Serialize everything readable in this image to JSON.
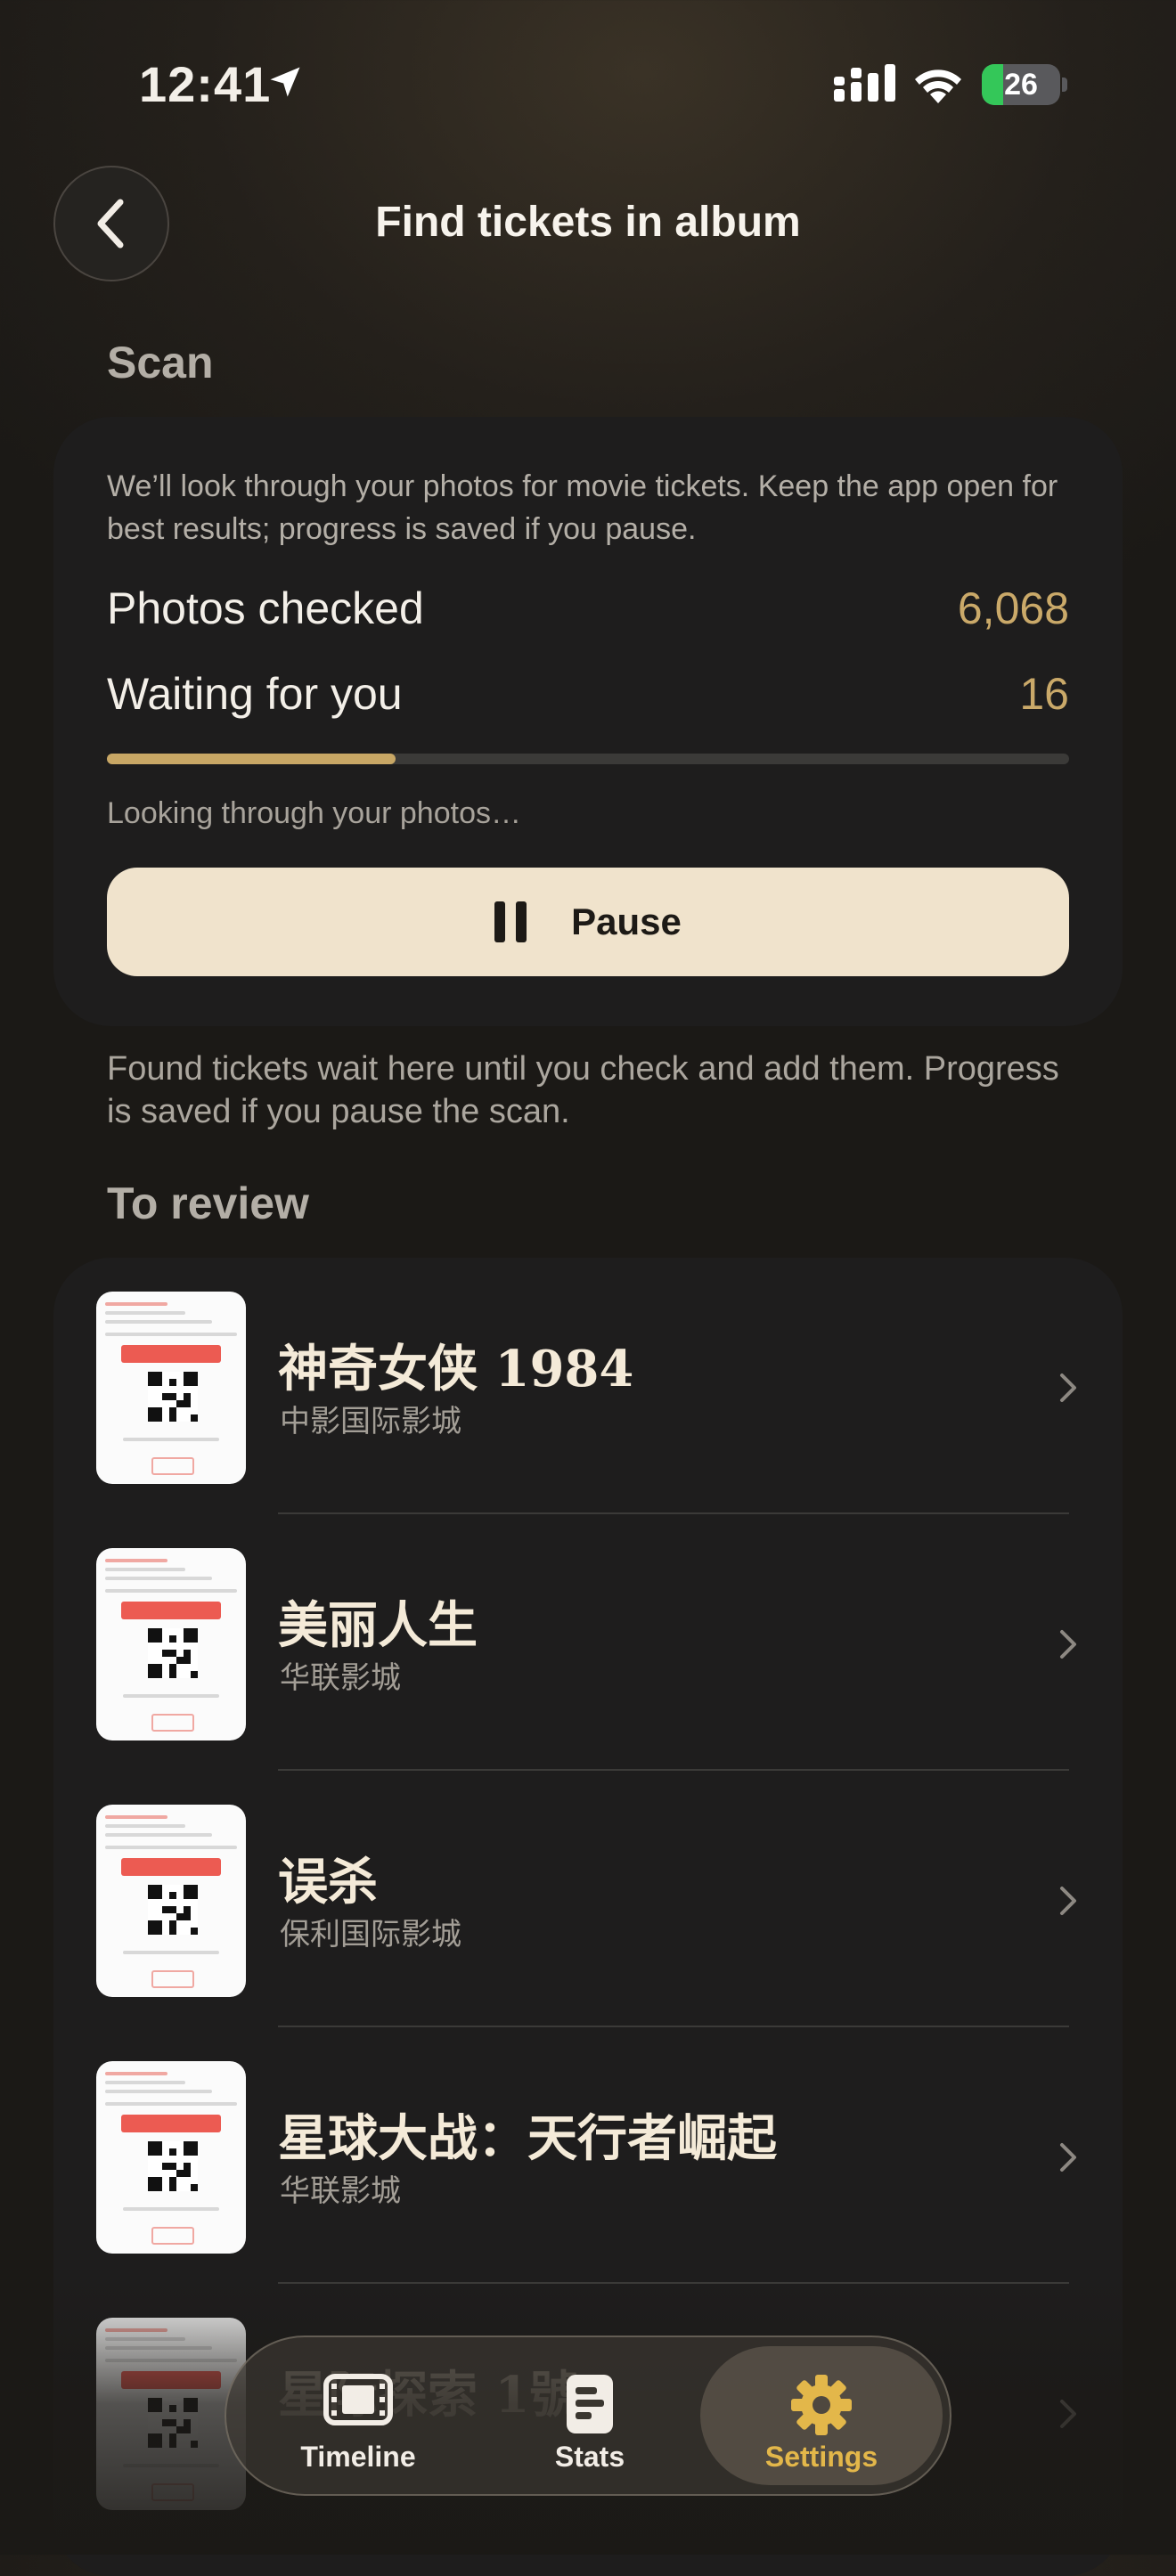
{
  "status_bar": {
    "time": "12:41",
    "battery": "26"
  },
  "header": {
    "title": "Find tickets in album"
  },
  "scan": {
    "section_title": "Scan",
    "description": "We’ll look through your photos for movie tickets. Keep the app open for best results; progress is saved if you pause.",
    "photos_checked_label": "Photos checked",
    "photos_checked_value": "6,068",
    "waiting_label": "Waiting for you",
    "waiting_value": "16",
    "progress_fraction": 0.3,
    "status_text": "Looking through your photos…",
    "pause_label": "Pause"
  },
  "hint": "Found tickets wait here until you check and add them. Progress is saved if you pause the scan.",
  "review": {
    "section_title": "To review",
    "items": [
      {
        "title": "神奇女侠 1984",
        "cinema": "中影国际影城"
      },
      {
        "title": "美丽人生",
        "cinema": "华联影城"
      },
      {
        "title": "误杀",
        "cinema": "保利国际影城"
      },
      {
        "title": "星球大战：天行者崛起",
        "cinema": "华联影城"
      },
      {
        "title": "星际探索 1號",
        "cinema": ""
      }
    ]
  },
  "tabbar": {
    "tabs": [
      {
        "label": "Timeline",
        "icon": "film-icon"
      },
      {
        "label": "Stats",
        "icon": "stats-icon"
      },
      {
        "label": "Settings",
        "icon": "gear-icon",
        "active": true
      }
    ]
  },
  "colors": {
    "accent": "#c8a765",
    "accent_tab": "#e3b74a",
    "button_bg": "#f0e3cc",
    "card_bg": "#1e1d1d"
  }
}
